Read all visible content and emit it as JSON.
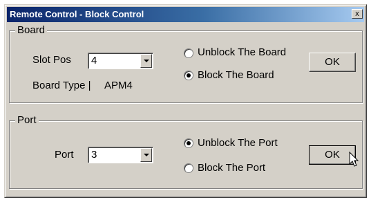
{
  "window": {
    "title": "Remote Control - Block Control",
    "close_label": "x"
  },
  "board": {
    "legend": "Board",
    "slot_pos_label": "Slot Pos",
    "slot_pos_value": "4",
    "board_type_label": "Board Type |",
    "board_type_value": "APM4",
    "unblock_label": "Unblock The Board",
    "block_label": "Block The Board",
    "selected": "block",
    "ok_label": "OK"
  },
  "port": {
    "legend": "Port",
    "port_label": "Port",
    "port_value": "3",
    "unblock_label": "Unblock The Port",
    "block_label": "Block The Port",
    "selected": "unblock",
    "ok_label": "OK"
  }
}
